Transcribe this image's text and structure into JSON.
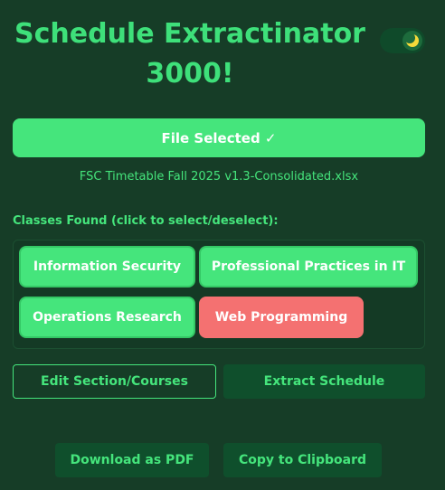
{
  "app": {
    "title": "Schedule Extractinator 3000!",
    "title_line1": "Schedule Extractinator",
    "title_line2": "3000!"
  },
  "theme_toggle": {
    "icon": "moon-icon",
    "state": "dark"
  },
  "file": {
    "button_label": "File Selected ✓",
    "file_name": "FSC Timetable Fall 2025 v1.3-Consolidated.xlsx"
  },
  "classes": {
    "label": "Classes Found (click to select/deselect):",
    "items": [
      {
        "name": "Information Security",
        "selected": true
      },
      {
        "name": "Professional Practices in IT",
        "selected": true
      },
      {
        "name": "Operations Research",
        "selected": true
      },
      {
        "name": "Web Programming",
        "selected": false
      }
    ]
  },
  "actions": {
    "edit_label": "Edit Section/Courses",
    "extract_label": "Extract Schedule",
    "download_label": "Download as PDF",
    "copy_label": "Copy to Clipboard"
  },
  "colors": {
    "background": "#163d27",
    "accent": "#45e57c",
    "deselected": "#f47171",
    "dark_button": "#0f4f2c"
  }
}
